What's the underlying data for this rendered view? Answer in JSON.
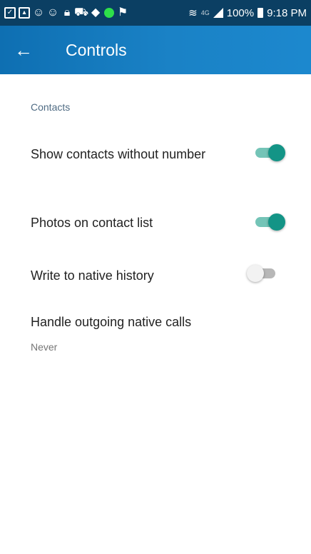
{
  "status_bar": {
    "network": "4G",
    "battery": "100%",
    "time": "9:18 PM",
    "colors": {
      "background": "#0b3f63",
      "notification_dot": "#2ee04a"
    }
  },
  "app_bar": {
    "back_icon": "arrow-left-icon",
    "title": "Controls",
    "color": "#1a82c6"
  },
  "section": {
    "header": "Contacts"
  },
  "preferences": [
    {
      "title": "Show contacts without number",
      "type": "switch",
      "checked": true
    },
    {
      "title": "Photos on contact list",
      "type": "switch",
      "checked": true
    },
    {
      "title": "Write to native history",
      "type": "switch",
      "checked": false
    },
    {
      "title": "Handle outgoing native calls",
      "type": "list",
      "value": "Never"
    }
  ],
  "switch_colors": {
    "on_thumb": "#139486",
    "on_track": "#74c4b7",
    "off_thumb": "#f2f2f2",
    "off_track": "#b7b7b7"
  }
}
